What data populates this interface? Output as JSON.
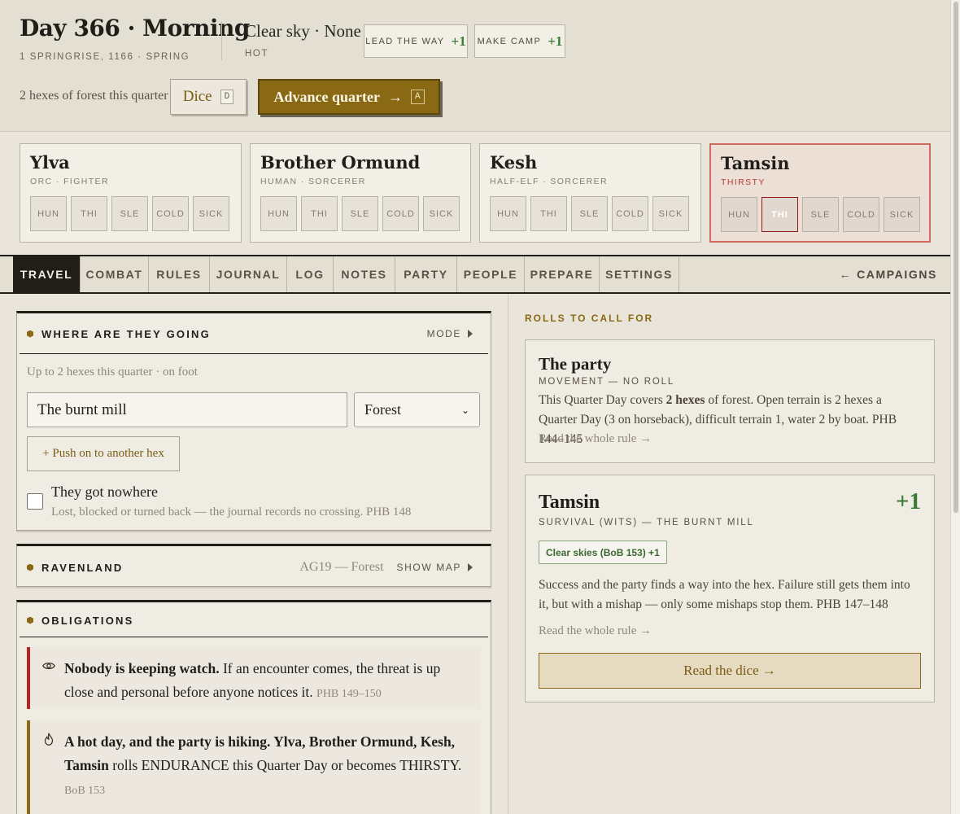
{
  "header": {
    "day_title": "Day 366 · Morning",
    "date": "1 SPRINGRISE, 1166 · SPRING",
    "weather": "Clear sky · None",
    "temperature": "HOT",
    "lead_the_way": {
      "label": "LEAD THE WAY",
      "bonus": "+1"
    },
    "make_camp": {
      "label": "MAKE CAMP",
      "bonus": "+1"
    },
    "forest_note": "2 hexes of forest this quarter",
    "dice": {
      "label": "Dice",
      "key": "D"
    },
    "advance": {
      "label": "Advance quarter",
      "arrow": "→",
      "key": "A"
    }
  },
  "party": [
    {
      "name": "Ylva",
      "meta": "ORC · FIGHTER",
      "conditions": [
        "HUN",
        "THI",
        "SLE",
        "COLD",
        "SICK"
      ],
      "active": []
    },
    {
      "name": "Brother Ormund",
      "meta": "HUMAN · SORCERER",
      "conditions": [
        "HUN",
        "THI",
        "SLE",
        "COLD",
        "SICK"
      ],
      "active": []
    },
    {
      "name": "Kesh",
      "meta": "HALF-ELF · SORCERER",
      "conditions": [
        "HUN",
        "THI",
        "SLE",
        "COLD",
        "SICK"
      ],
      "active": []
    },
    {
      "name": "Tamsin",
      "meta": "THIRSTY",
      "conditions": [
        "HUN",
        "THI",
        "SLE",
        "COLD",
        "SICK"
      ],
      "active": [
        "THI"
      ]
    }
  ],
  "tabs": [
    "TRAVEL",
    "COMBAT",
    "RULES",
    "JOURNAL",
    "LOG",
    "NOTES",
    "PARTY",
    "PEOPLE",
    "PREPARE",
    "SETTINGS"
  ],
  "active_tab": "TRAVEL",
  "back": {
    "arrow": "←",
    "label": "CAMPAIGNS"
  },
  "where": {
    "title": "WHERE ARE THEY GOING",
    "mode_label": "MODE",
    "subtitle": "Up to 2 hexes this quarter · on foot",
    "destination_value": "The burnt mill",
    "terrain_value": "Forest",
    "push_label": "+ Push on to another hex",
    "nowhere_label": "They got nowhere",
    "nowhere_sub": "Lost, blocked or turned back — the journal records no crossing. PHB 148"
  },
  "region": {
    "title": "RAVENLAND",
    "code": "AG19 — Forest",
    "map_label": "SHOW MAP"
  },
  "obligations": {
    "title": "OBLIGATIONS",
    "items": [
      {
        "icon": "eye-icon",
        "bold": "Nobody is keeping watch.",
        "text": " If an encounter comes, the threat is up close and personal before anyone notices it. ",
        "ref": "PHB 149–150"
      },
      {
        "icon": "flame-icon",
        "bold": "A hot day, and the party is hiking. Ylva, Brother Ormund, Kesh, Tamsin",
        "text": " rolls ENDURANCE this Quarter Day or becomes THIRSTY. ",
        "ref": "BoB 153"
      }
    ]
  },
  "rolls": {
    "title": "ROLLS TO CALL FOR",
    "party_card": {
      "name": "The party",
      "kind": "MOVEMENT — NO ROLL",
      "body_pre": "This Quarter Day covers ",
      "body_bold": "2 hexes",
      "body_post": " of forest. Open terrain is 2 hexes a Quarter Day (3 on horseback), difficult terrain 1, water 2 by boat. PHB 144–145",
      "link": "Read the whole rule →"
    },
    "tamsin_card": {
      "name": "Tamsin",
      "bonus": "+1",
      "kind": "SURVIVAL (WITS) — THE BURNT MILL",
      "chip": "Clear skies (BoB 153) +1",
      "body": "Success and the party finds a way into the hex. Failure still gets them into it, but with a mishap — only some mishaps stop them. PHB 147–148",
      "link": "Read the whole rule →",
      "button": "Read the dice →"
    }
  }
}
